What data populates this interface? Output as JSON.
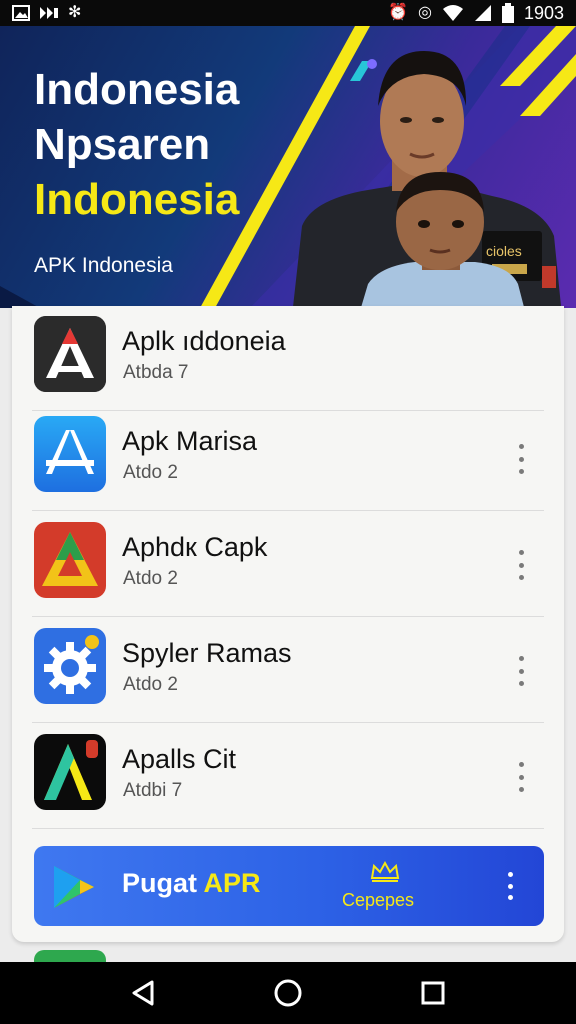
{
  "status_bar": {
    "time": "1903",
    "left_icons": [
      "image-icon",
      "cast-icon",
      "snowflake-icon"
    ],
    "right_icons": [
      "alarm-icon",
      "alarm-clock-icon",
      "wifi-icon",
      "signal-icon",
      "battery-icon"
    ]
  },
  "banner": {
    "title_line1": "Indonesia",
    "title_line2": "Npsaren",
    "title_line3": "Indonesia",
    "subtitle": "APK Indonesia",
    "badge_text": "cioles",
    "accent_color": "#f6e816"
  },
  "apps": [
    {
      "name": "Aplk ıddoneia",
      "sub": "Atbda 7",
      "icon": "app-a-dark-icon",
      "has_menu": false
    },
    {
      "name": "Apk Marisa",
      "sub": "Atdo 2",
      "icon": "app-store-icon",
      "has_menu": true
    },
    {
      "name": "Aphdк Capk",
      "sub": "Atdo 2",
      "icon": "app-triangle-icon",
      "has_menu": true
    },
    {
      "name": "Spyler Ramas",
      "sub": "Atdo 2",
      "icon": "gear-icon",
      "has_menu": true
    },
    {
      "name": "Apalls Cit",
      "sub": "Atdbi 7",
      "icon": "app-a-neon-icon",
      "has_menu": true
    }
  ],
  "promo": {
    "title_main": "Pugat ",
    "title_accent": "APR",
    "sub": "Cepepes",
    "icon": "play-store-icon",
    "badge_icon": "crown-icon"
  },
  "nav": {
    "back": "back-icon",
    "home": "home-icon",
    "recents": "recents-icon"
  }
}
